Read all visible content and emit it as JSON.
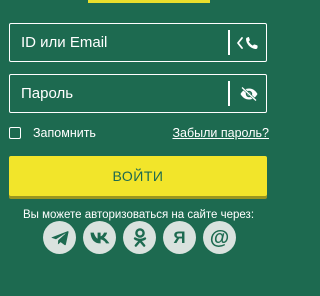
{
  "form": {
    "login_placeholder": "ID или Email",
    "password_placeholder": "Пароль",
    "remember_label": "Запомнить",
    "forgot_label": "Забыли пароль?",
    "submit_label": "ВОЙТИ",
    "social_text": "Вы можете авторизоваться на сайте через:"
  },
  "icons": {
    "login_field": "phone-switch-icon",
    "password_field": "eye-slash-icon"
  },
  "social": [
    {
      "name": "telegram-icon"
    },
    {
      "name": "vk-icon"
    },
    {
      "name": "odnoklassniki-icon"
    },
    {
      "name": "yandex-icon",
      "glyph": "Я"
    },
    {
      "name": "email-icon",
      "glyph": "@"
    }
  ],
  "colors": {
    "background": "#1d6a50",
    "accent": "#f2e52a",
    "text": "#ffffff",
    "social_bg": "#d9e2de"
  }
}
